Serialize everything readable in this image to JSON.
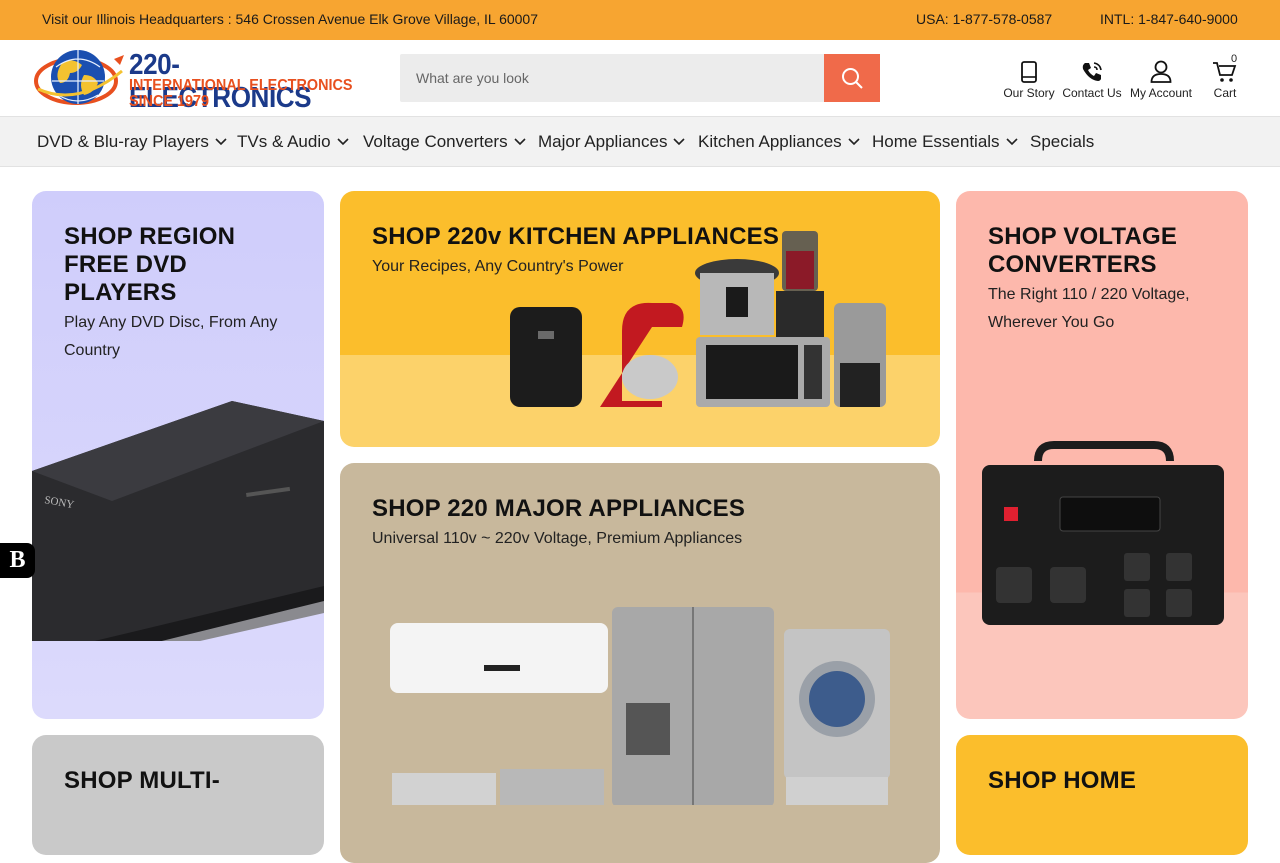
{
  "topbar": {
    "address": "Visit our Illinois Headquarters : 546 Crossen Avenue Elk Grove Village, IL 60007",
    "usa_phone": "USA: 1-877-578-0587",
    "intl_phone": "INTL: 1-847-640-9000"
  },
  "logo": {
    "name": "220-ELECTRONICS",
    "tagline": "INTERNATIONAL ELECTRONICS",
    "since": "SINCE 1979"
  },
  "search": {
    "placeholder": "What are you look"
  },
  "header_links": {
    "our_story": "Our Story",
    "contact_us": "Contact Us",
    "my_account": "My Account",
    "cart": "Cart",
    "cart_count": "0"
  },
  "nav": {
    "items": [
      {
        "label": "DVD & Blu-ray Players"
      },
      {
        "label": "TVs & Audio"
      },
      {
        "label": "Voltage Converters"
      },
      {
        "label": "Major Appliances"
      },
      {
        "label": "Kitchen Appliances"
      },
      {
        "label": "Home Essentials"
      },
      {
        "label": "Specials"
      }
    ]
  },
  "cards": {
    "dvd": {
      "title": "SHOP REGION FREE DVD PLAYERS",
      "subtitle": "Play Any DVD Disc, From Any Country",
      "brand": "SONY",
      "color": "#d2d0fc"
    },
    "kitchen": {
      "title": "SHOP 220v KITCHEN APPLIANCES",
      "subtitle": "Your Recipes, Any Country's Power",
      "color": "#fbbe2c"
    },
    "voltage": {
      "title": "SHOP VOLTAGE CONVERTERS",
      "subtitle": "The Right 110 / 220 Voltage, Wherever You Go",
      "color": "#fdb8ac"
    },
    "major": {
      "title": "SHOP 220 MAJOR APPLIANCES",
      "subtitle": "Universal 110v ~ 220v Voltage, Premium Appliances",
      "color": "#c8b89c"
    },
    "multi": {
      "title": "SHOP MULTI-",
      "color": "#c9c9c9"
    },
    "home": {
      "title": "SHOP HOME",
      "color": "#fbbe2c"
    }
  },
  "side_tab": {
    "letter": "B"
  }
}
